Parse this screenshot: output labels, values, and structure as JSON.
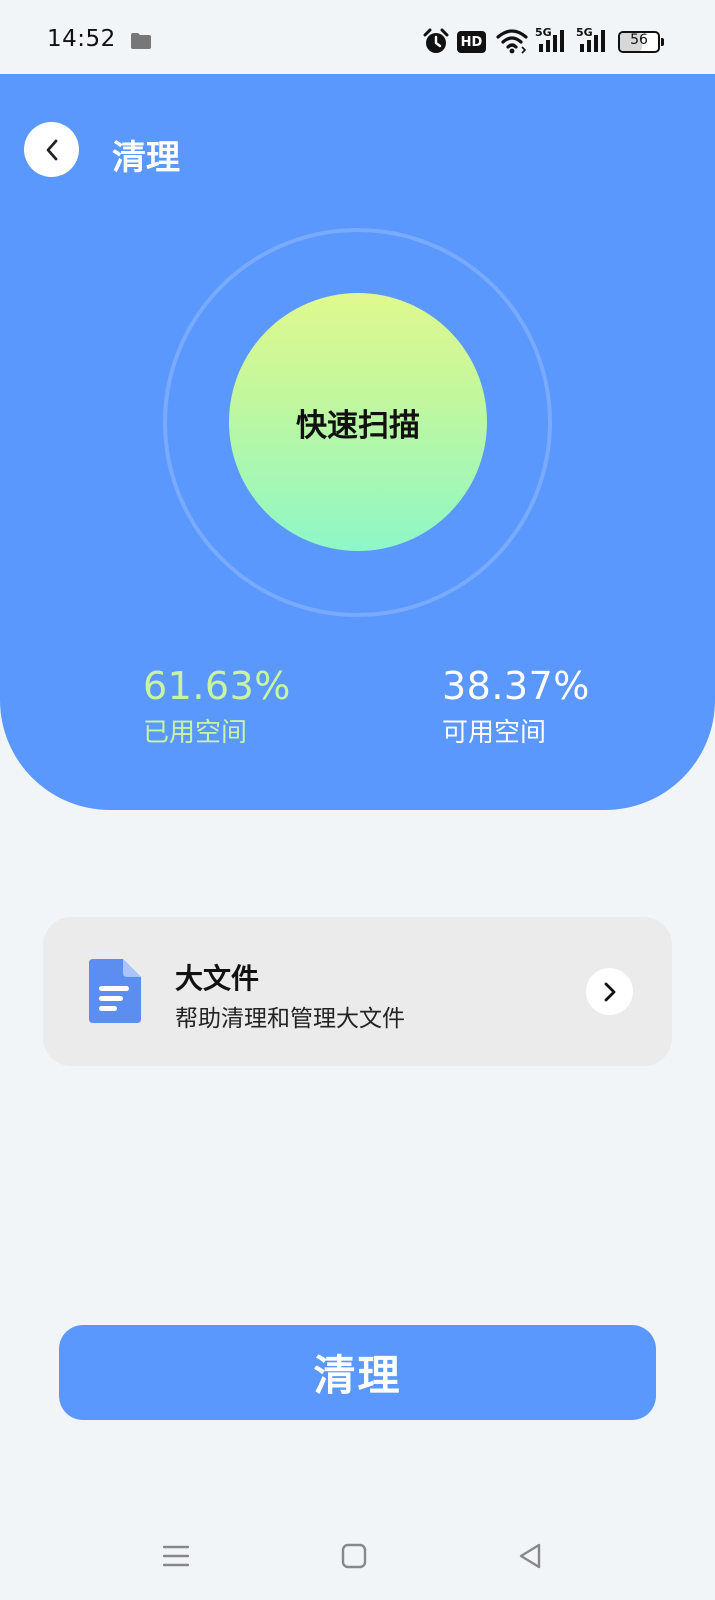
{
  "status_bar": {
    "time": "14:52",
    "icons": [
      "folder-icon",
      "alarm-icon",
      "hd-icon",
      "wifi-icon",
      "signal-5g-icon",
      "signal-5g-icon",
      "battery-icon"
    ],
    "hd_text": "HD",
    "net1": "5G",
    "net2": "5G",
    "battery": "56"
  },
  "header": {
    "back_icon": "chevron-left-icon",
    "title": "清理"
  },
  "scan": {
    "label": "快速扫描"
  },
  "storage": {
    "used_value": "61.63%",
    "used_label": "已用空间",
    "free_value": "38.37%",
    "free_label": "可用空间"
  },
  "large_files": {
    "icon": "document-icon",
    "title": "大文件",
    "subtitle": "帮助清理和管理大文件",
    "arrow_icon": "chevron-right-icon"
  },
  "actions": {
    "clean_label": "清理"
  },
  "nav": {
    "items": [
      "menu-icon",
      "home-square-icon",
      "back-triangle-icon"
    ]
  },
  "colors": {
    "primary": "#5b98fd",
    "used_green": "#c8f5a0",
    "page_bg": "#f2f5f8",
    "card_bg": "#ebebeb"
  }
}
